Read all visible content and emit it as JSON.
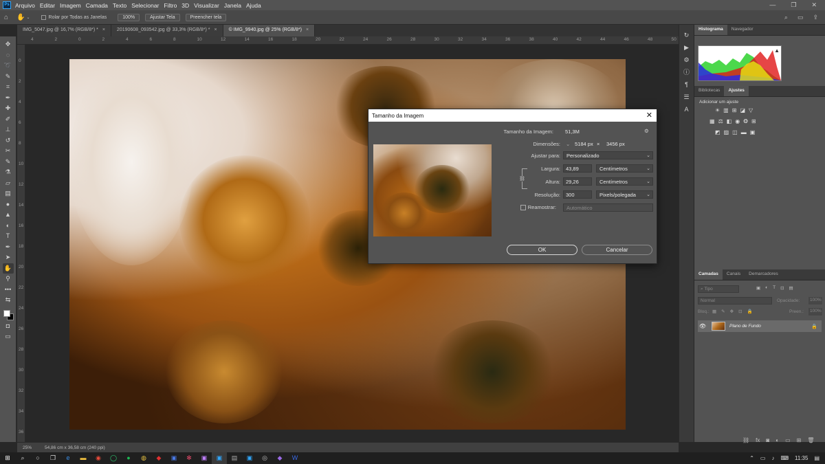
{
  "menubar": {
    "app_logo": "Ps",
    "items": [
      "Arquivo",
      "Editar",
      "Imagem",
      "Camada",
      "Texto",
      "Selecionar",
      "Filtro",
      "3D",
      "Visualizar",
      "Janela",
      "Ajuda"
    ],
    "window_controls": [
      "—",
      "❐",
      "✕"
    ]
  },
  "options_bar": {
    "scroll_all_label": "Rolar por Todas as Janelas",
    "zoom_100": "100%",
    "fit_screen": "Ajustar Tela",
    "fill_screen": "Preencher tela"
  },
  "tabs": [
    {
      "label": "IMG_5047.jpg @ 16,7% (RGB/8*) *",
      "active": false
    },
    {
      "label": "20190608_093542.jpg @ 33,3% (RGB/8*) *",
      "active": false
    },
    {
      "label": "© IMG_9940.jpg @ 25% (RGB/8*)",
      "active": true
    }
  ],
  "ruler_top": [
    "4",
    "2",
    "0",
    "2",
    "4",
    "6",
    "8",
    "10",
    "12",
    "14",
    "16",
    "18",
    "20",
    "22",
    "24",
    "26",
    "28",
    "30",
    "32",
    "34",
    "36",
    "38",
    "40",
    "42",
    "44",
    "46",
    "48",
    "50"
  ],
  "ruler_left": [
    "0",
    "2",
    "4",
    "6",
    "8",
    "10",
    "12",
    "14",
    "16",
    "18",
    "20",
    "22",
    "24",
    "26",
    "28",
    "30",
    "32",
    "34",
    "36"
  ],
  "status": {
    "zoom": "25%",
    "info": "54,86 cm x 36,58 cm (240 ppi)"
  },
  "panels": {
    "top_tabs": [
      "Histograma",
      "Navegador"
    ],
    "mid_tabs": [
      "Bibliotecas",
      "Ajustes"
    ],
    "adjust_title": "Adicionar um ajuste",
    "layers_tabs": [
      "Camadas",
      "Canais",
      "Demarcadores"
    ],
    "layer_filter": "Tipo",
    "blend_mode": "Normal",
    "opacity_label": "Opacidade:",
    "opacity_value": "100%",
    "lock_label": "Bloq.:",
    "fill_label": "Preen.:",
    "fill_value": "100%",
    "layer_name": "Plano de Fundo"
  },
  "dialog": {
    "title": "Tamanho da Imagem",
    "image_size_label": "Tamanho da Imagem:",
    "image_size_value": "51,3M",
    "dimensions_label": "Dimensões:",
    "dim_w": "5184 px",
    "dim_x": "×",
    "dim_h": "3456 px",
    "fit_label": "Ajustar para:",
    "fit_value": "Personalizado",
    "width_label": "Largura:",
    "width_value": "43,89",
    "width_unit": "Centímetros",
    "height_label": "Altura:",
    "height_value": "29,26",
    "height_unit": "Centímetros",
    "resolution_label": "Resolução:",
    "resolution_value": "300",
    "resolution_unit": "Pixels/polegada",
    "resample_label": "Reamostrar:",
    "resample_value": "Automático",
    "ok": "OK",
    "cancel": "Cancelar"
  },
  "taskbar": {
    "time": "11:35"
  }
}
